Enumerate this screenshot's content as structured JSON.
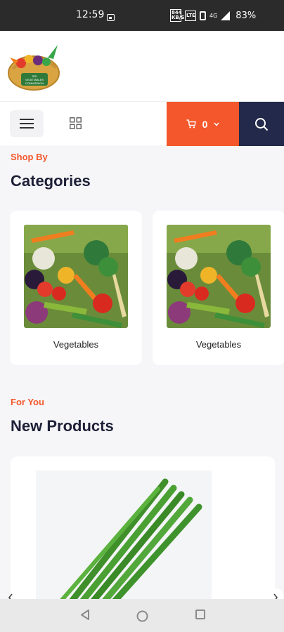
{
  "status_bar": {
    "time": "12:59",
    "net_badge_top": "844",
    "net_badge_bottom": "KB/S",
    "lte_badge": "LTE",
    "signal_label": "4G",
    "battery": "83%"
  },
  "header": {
    "logo_icon": "vegetable-basket-logo",
    "logo_text_line1": "SRI",
    "logo_text_line2": "VEGETABLES",
    "logo_text_line3": "COMMISSION"
  },
  "toolbar": {
    "menu_icon": "hamburger-icon",
    "grid_icon": "grid-icon",
    "cart_count": "0",
    "cart_icon": "cart-icon",
    "search_icon": "search-icon",
    "accent_color": "#f4572b",
    "dark_color": "#23294a"
  },
  "categories": {
    "eyebrow": "Shop By",
    "title": "Categories",
    "items": [
      {
        "label": "Vegetables"
      },
      {
        "label": "Vegetables"
      }
    ]
  },
  "new_products": {
    "eyebrow": "For You",
    "title": "New Products"
  },
  "carousel": {
    "prev_icon": "chevron-left-icon",
    "next_icon": "chevron-right-icon"
  },
  "nav_bar": {
    "back_icon": "back-triangle-icon",
    "home_icon": "home-circle-icon",
    "recents_icon": "recents-square-icon"
  }
}
